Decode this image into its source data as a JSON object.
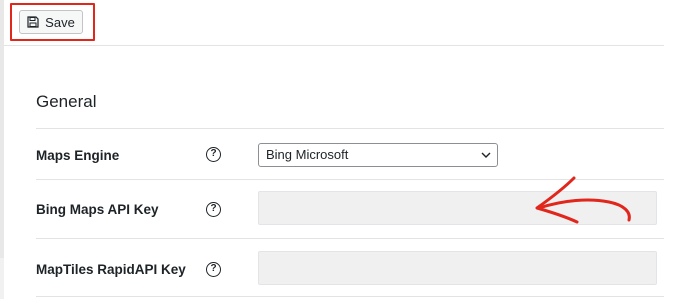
{
  "toolbar": {
    "save_label": "Save"
  },
  "section": {
    "title": "General"
  },
  "fields": [
    {
      "label": "Maps Engine",
      "help": "?",
      "type": "select",
      "value": "Bing Microsoft"
    },
    {
      "label": "Bing Maps API Key",
      "help": "?",
      "type": "text",
      "value": ""
    },
    {
      "label": "MapTiles RapidAPI Key",
      "help": "?",
      "type": "text",
      "value": ""
    }
  ],
  "colors": {
    "highlight": "#e1261c",
    "arrow": "#e1261c"
  },
  "icons": {
    "save": "floppy-disk-icon",
    "dropdown": "chevron-down-icon",
    "help": "question-circle-icon"
  }
}
